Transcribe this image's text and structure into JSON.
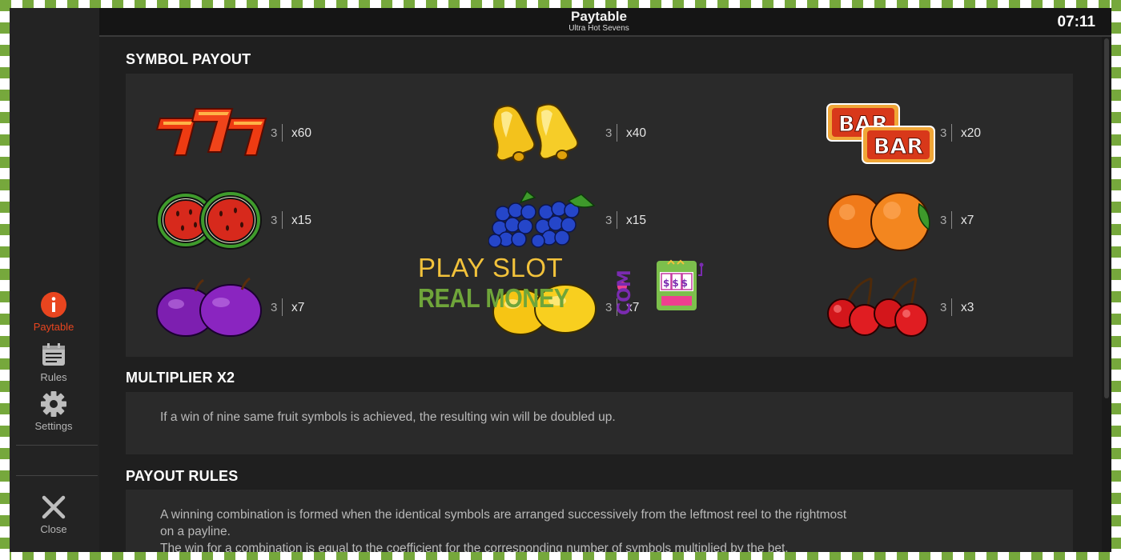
{
  "header": {
    "title": "Paytable",
    "subtitle": "Ultra Hot Sevens",
    "clock": "07:11"
  },
  "sidebar": {
    "items": [
      {
        "label": "Paytable",
        "icon": "info-icon",
        "active": true
      },
      {
        "label": "Rules",
        "icon": "calendar-icon"
      },
      {
        "label": "Settings",
        "icon": "gear-icon"
      },
      {
        "label": "Close",
        "icon": "close-icon"
      }
    ]
  },
  "symbol_payout": {
    "title": "SYMBOL PAYOUT",
    "symbols": [
      {
        "name": "seven",
        "count": "3",
        "mult": "x60"
      },
      {
        "name": "bell",
        "count": "3",
        "mult": "x40"
      },
      {
        "name": "bar",
        "count": "3",
        "mult": "x20",
        "label": "BAR"
      },
      {
        "name": "watermelon",
        "count": "3",
        "mult": "x15"
      },
      {
        "name": "grapes",
        "count": "3",
        "mult": "x15"
      },
      {
        "name": "orange",
        "count": "3",
        "mult": "x7"
      },
      {
        "name": "plum",
        "count": "3",
        "mult": "x7"
      },
      {
        "name": "lemon",
        "count": "3",
        "mult": "x7"
      },
      {
        "name": "cherry",
        "count": "3",
        "mult": "x3"
      }
    ]
  },
  "multiplier": {
    "title": "MULTIPLIER X2",
    "text": "If a win of nine same fruit symbols is achieved, the resulting win will be doubled up."
  },
  "payout_rules": {
    "title": "PAYOUT RULES",
    "line1": "A winning combination is formed when the identical symbols are arranged successively from the leftmost reel to the rightmost",
    "line2": "on a payline.",
    "line3": "The win for a combination is equal to the coefficient for the corresponding number of symbols multiplied by the bet."
  },
  "watermark": {
    "line1": "PLAY SLOT",
    "line2": "REAL MONEY",
    "com": "COM",
    "slot_text": "$$$"
  },
  "colors": {
    "accent": "#e8451f",
    "background": "#1f1f1f",
    "panel": "#2a2a2a",
    "frame_green": "#76a83c"
  }
}
